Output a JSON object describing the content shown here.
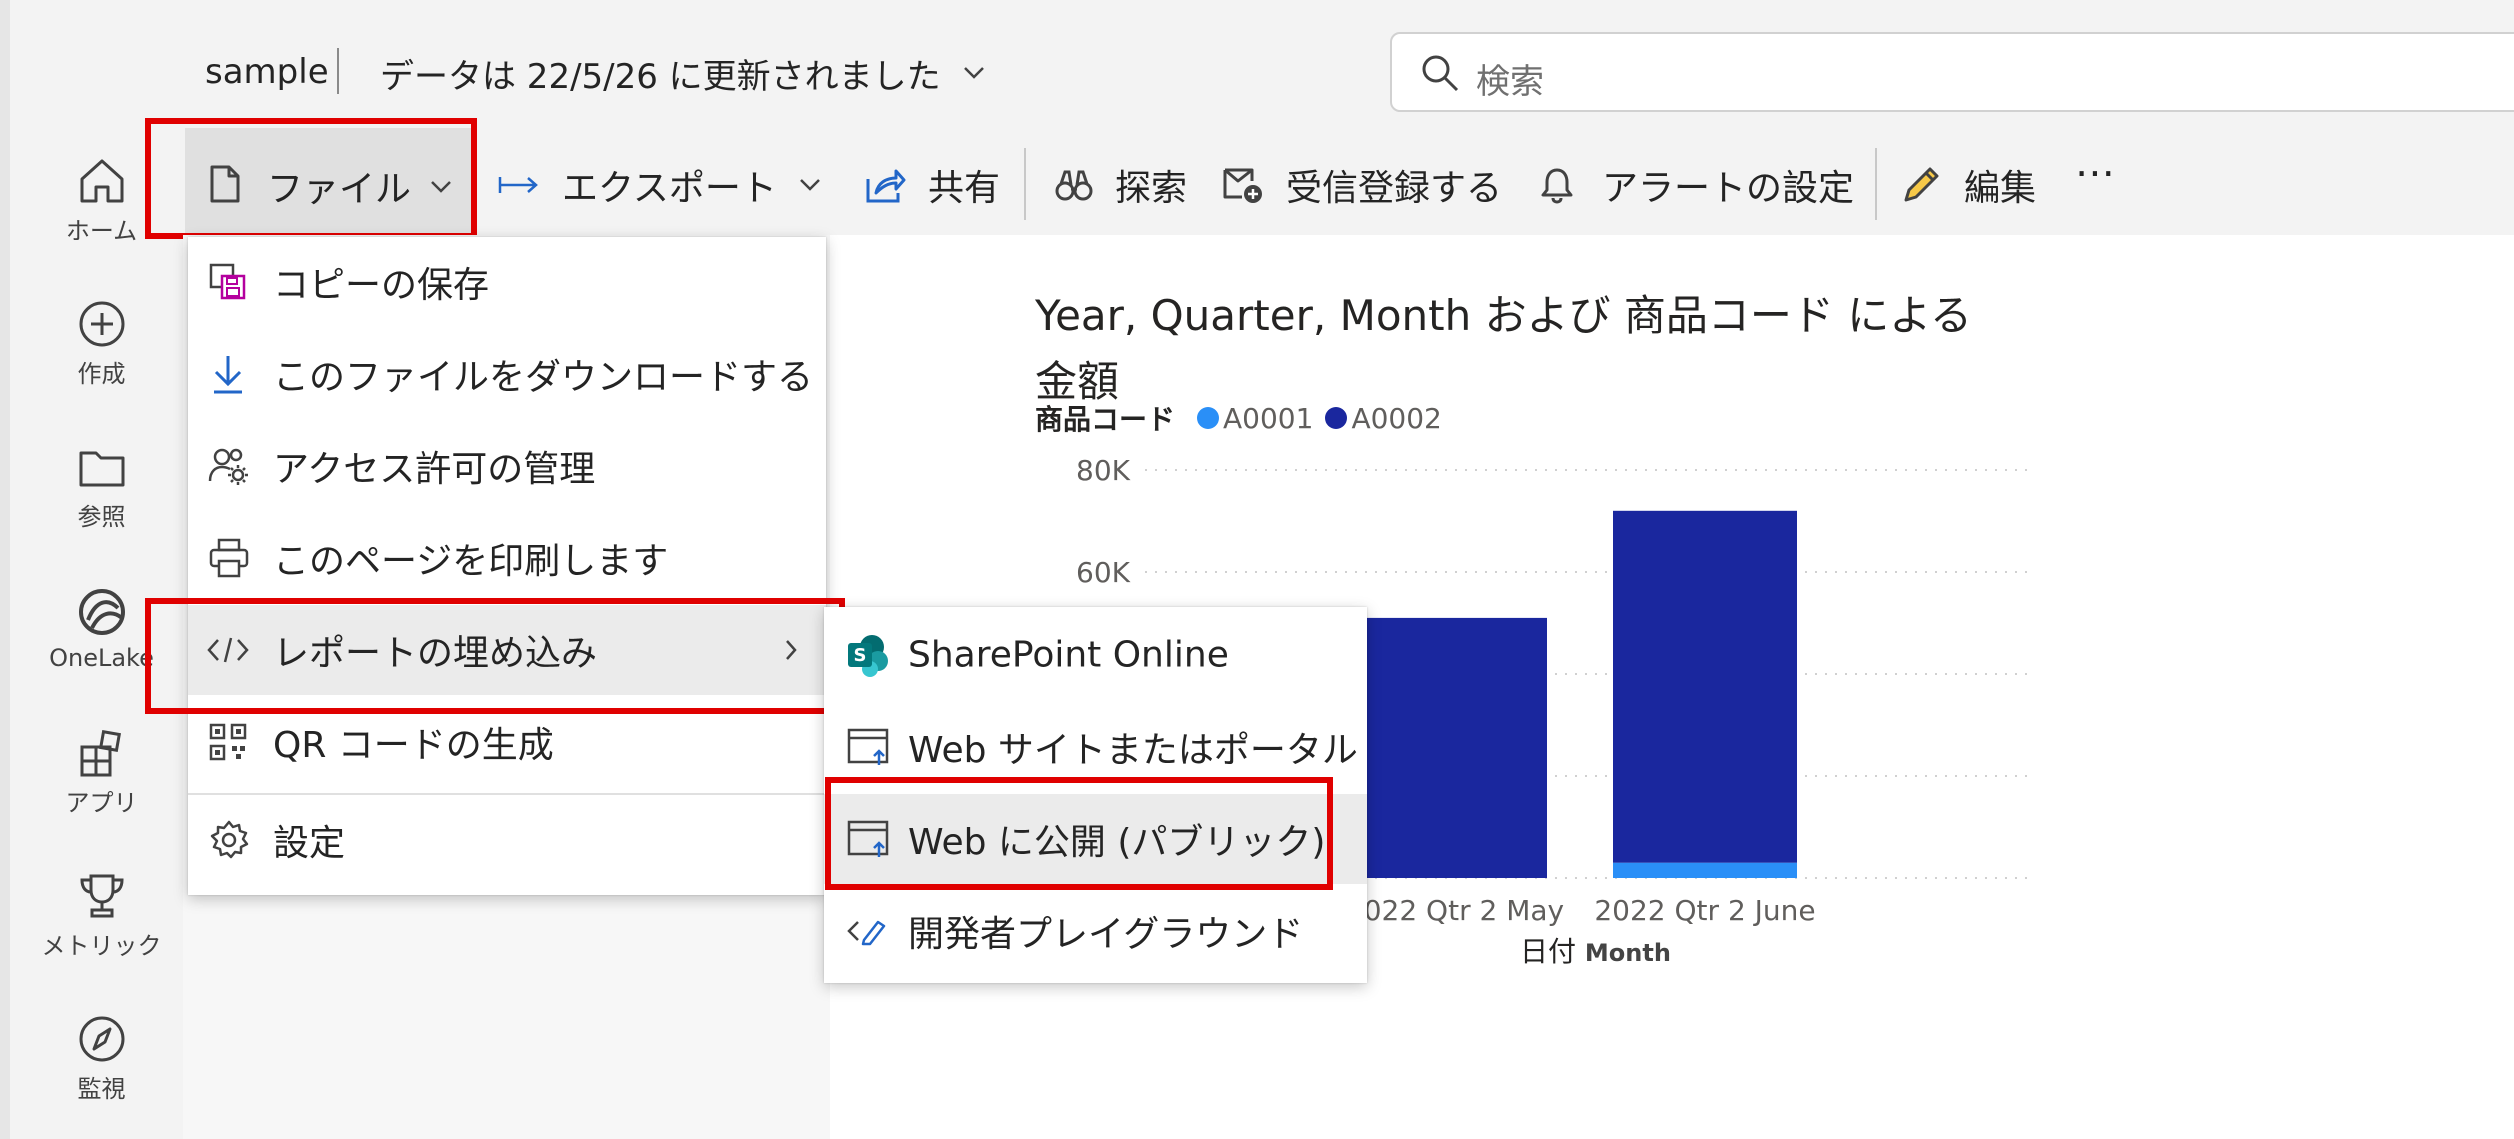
{
  "header": {
    "app_name": "sample",
    "data_updated": "データは 22/5/26 に更新されました",
    "search_placeholder": "検索"
  },
  "rail": {
    "items": [
      {
        "label": "ホーム",
        "icon": "home-icon"
      },
      {
        "label": "作成",
        "icon": "add-circle-icon"
      },
      {
        "label": "参照",
        "icon": "folder-icon"
      },
      {
        "label": "OneLake",
        "icon": "onelake-icon"
      },
      {
        "label": "アプリ",
        "icon": "apps-icon"
      },
      {
        "label": "メトリック",
        "icon": "trophy-icon"
      },
      {
        "label": "監視",
        "icon": "compass-icon"
      }
    ]
  },
  "toolbar": {
    "file": "ファイル",
    "export": "エクスポート",
    "share": "共有",
    "explore": "探索",
    "subscribe": "受信登録する",
    "alert": "アラートの設定",
    "edit": "編集",
    "more": "⋯"
  },
  "file_menu": {
    "items": [
      {
        "label": "コピーの保存",
        "icon": "save-copy-icon"
      },
      {
        "label": "このファイルをダウンロードする",
        "icon": "download-icon"
      },
      {
        "label": "アクセス許可の管理",
        "icon": "manage-access-icon"
      },
      {
        "label": "このページを印刷します",
        "icon": "print-icon"
      },
      {
        "label": "レポートの埋め込み",
        "icon": "code-icon"
      },
      {
        "label": "QR コードの生成",
        "icon": "qr-code-icon"
      },
      {
        "label": "設定",
        "icon": "gear-icon"
      }
    ]
  },
  "embed_submenu": {
    "items": [
      {
        "label": "SharePoint Online",
        "icon": "sharepoint-icon"
      },
      {
        "label": "Web サイトまたはポータル",
        "icon": "web-window-icon"
      },
      {
        "label": "Web に公開 (パブリック)",
        "icon": "web-publish-icon"
      },
      {
        "label": "開発者プレイグラウンド",
        "icon": "developer-icon"
      }
    ]
  },
  "colors": {
    "a0001": "#2a8ff7",
    "a0002": "#1a279e",
    "highlight": "#e00000"
  },
  "chart_data": {
    "type": "bar",
    "stacked": true,
    "title": "Year, Quarter, Month および 商品コード による 金額",
    "legend_title": "商品コード",
    "xlabel_prefix": "日付",
    "xlabel_field": "Month",
    "categories": [
      "2022 Qtr 2 May",
      "2022 Qtr 2 June"
    ],
    "series": [
      {
        "name": "A0001",
        "values": [
          0,
          3000
        ]
      },
      {
        "name": "A0002",
        "values": [
          51000,
          69000
        ]
      }
    ],
    "ytick_labels": [
      "80K",
      "60K"
    ],
    "ylim": [
      0,
      80000
    ],
    "grid": true,
    "legend_position": "top-left"
  }
}
